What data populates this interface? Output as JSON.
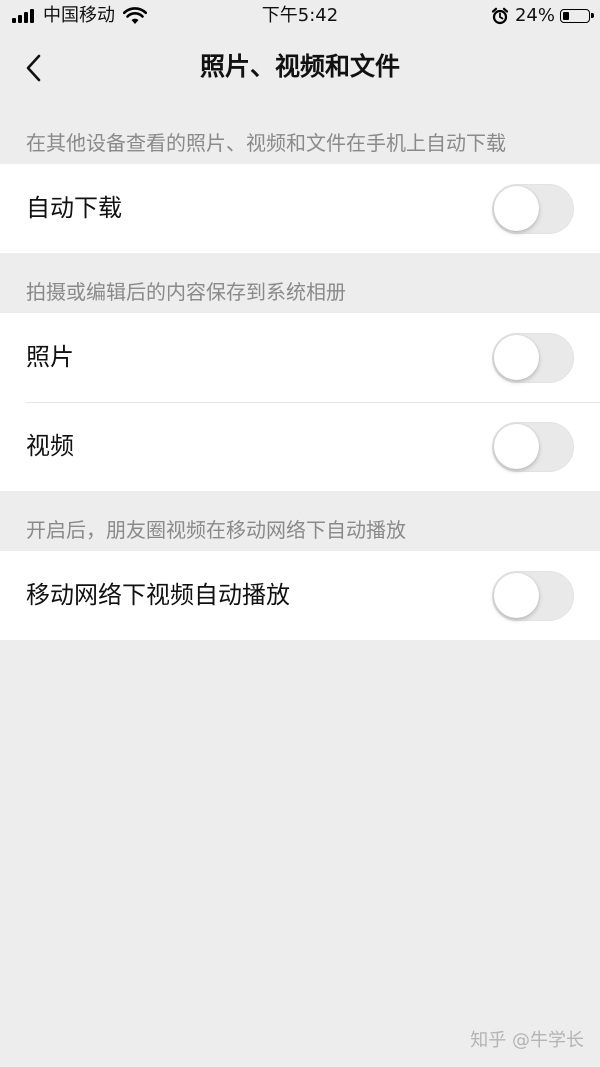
{
  "status_bar": {
    "carrier": "中国移动",
    "time": "下午5:42",
    "battery_percent": "24%",
    "battery_level": 0.24,
    "signal_bars": 4
  },
  "nav": {
    "back_icon": "chevron-left-icon",
    "title": "照片、视频和文件"
  },
  "sections": [
    {
      "header": "在其他设备查看的照片、视频和文件在手机上自动下载",
      "rows": [
        {
          "label": "自动下载",
          "toggle_on": false
        }
      ]
    },
    {
      "header": "拍摄或编辑后的内容保存到系统相册",
      "rows": [
        {
          "label": "照片",
          "toggle_on": false
        },
        {
          "label": "视频",
          "toggle_on": false
        }
      ]
    },
    {
      "header": "开启后，朋友圈视频在移动网络下自动播放",
      "rows": [
        {
          "label": "移动网络下视频自动播放",
          "toggle_on": false
        }
      ]
    }
  ],
  "watermark": "知乎 @牛学长",
  "colors": {
    "background": "#ededed",
    "toggle_off": "#e9e9ea",
    "header_text": "#8a8a8a"
  }
}
